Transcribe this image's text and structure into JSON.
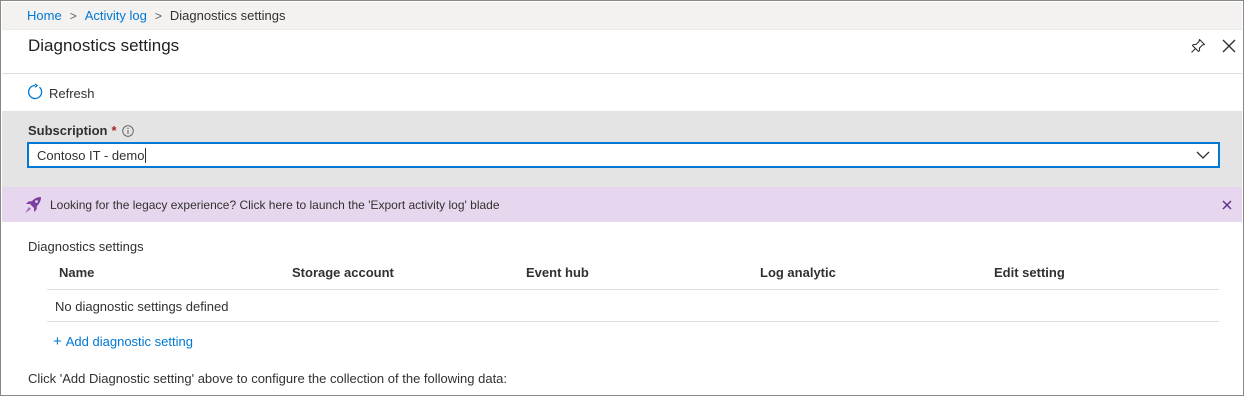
{
  "breadcrumb": {
    "items": [
      {
        "label": "Home"
      },
      {
        "label": "Activity log"
      }
    ],
    "current": "Diagnostics settings",
    "separator": ">"
  },
  "blade": {
    "title": "Diagnostics settings",
    "pin_icon": "pin-icon",
    "close_icon": "close-icon"
  },
  "toolbar": {
    "refresh_label": "Refresh",
    "refresh_icon": "refresh-icon"
  },
  "subscription": {
    "label": "Subscription",
    "required_marker": "*",
    "info_icon": "info-icon",
    "selected_value": "Contoso IT - demo",
    "dropdown_icon": "chevron-down-icon"
  },
  "banner": {
    "icon": "rocket-icon",
    "text": "Looking for the legacy experience? Click here to launch the 'Export activity log' blade",
    "dismiss_icon": "close-icon",
    "background": "#e6d7ee"
  },
  "diagnostics": {
    "section_label": "Diagnostics settings",
    "columns": [
      "Name",
      "Storage account",
      "Event hub",
      "Log analytic",
      "Edit setting"
    ],
    "empty_message": "No diagnostic settings defined",
    "add_label": "Add diagnostic setting",
    "add_icon": "plus-icon"
  },
  "footer": {
    "text": "Click 'Add Diagnostic setting' above to configure the collection of the following data:"
  },
  "colors": {
    "accent": "#0078d4",
    "required": "#a4262c",
    "panel": "#e4e4e4"
  }
}
